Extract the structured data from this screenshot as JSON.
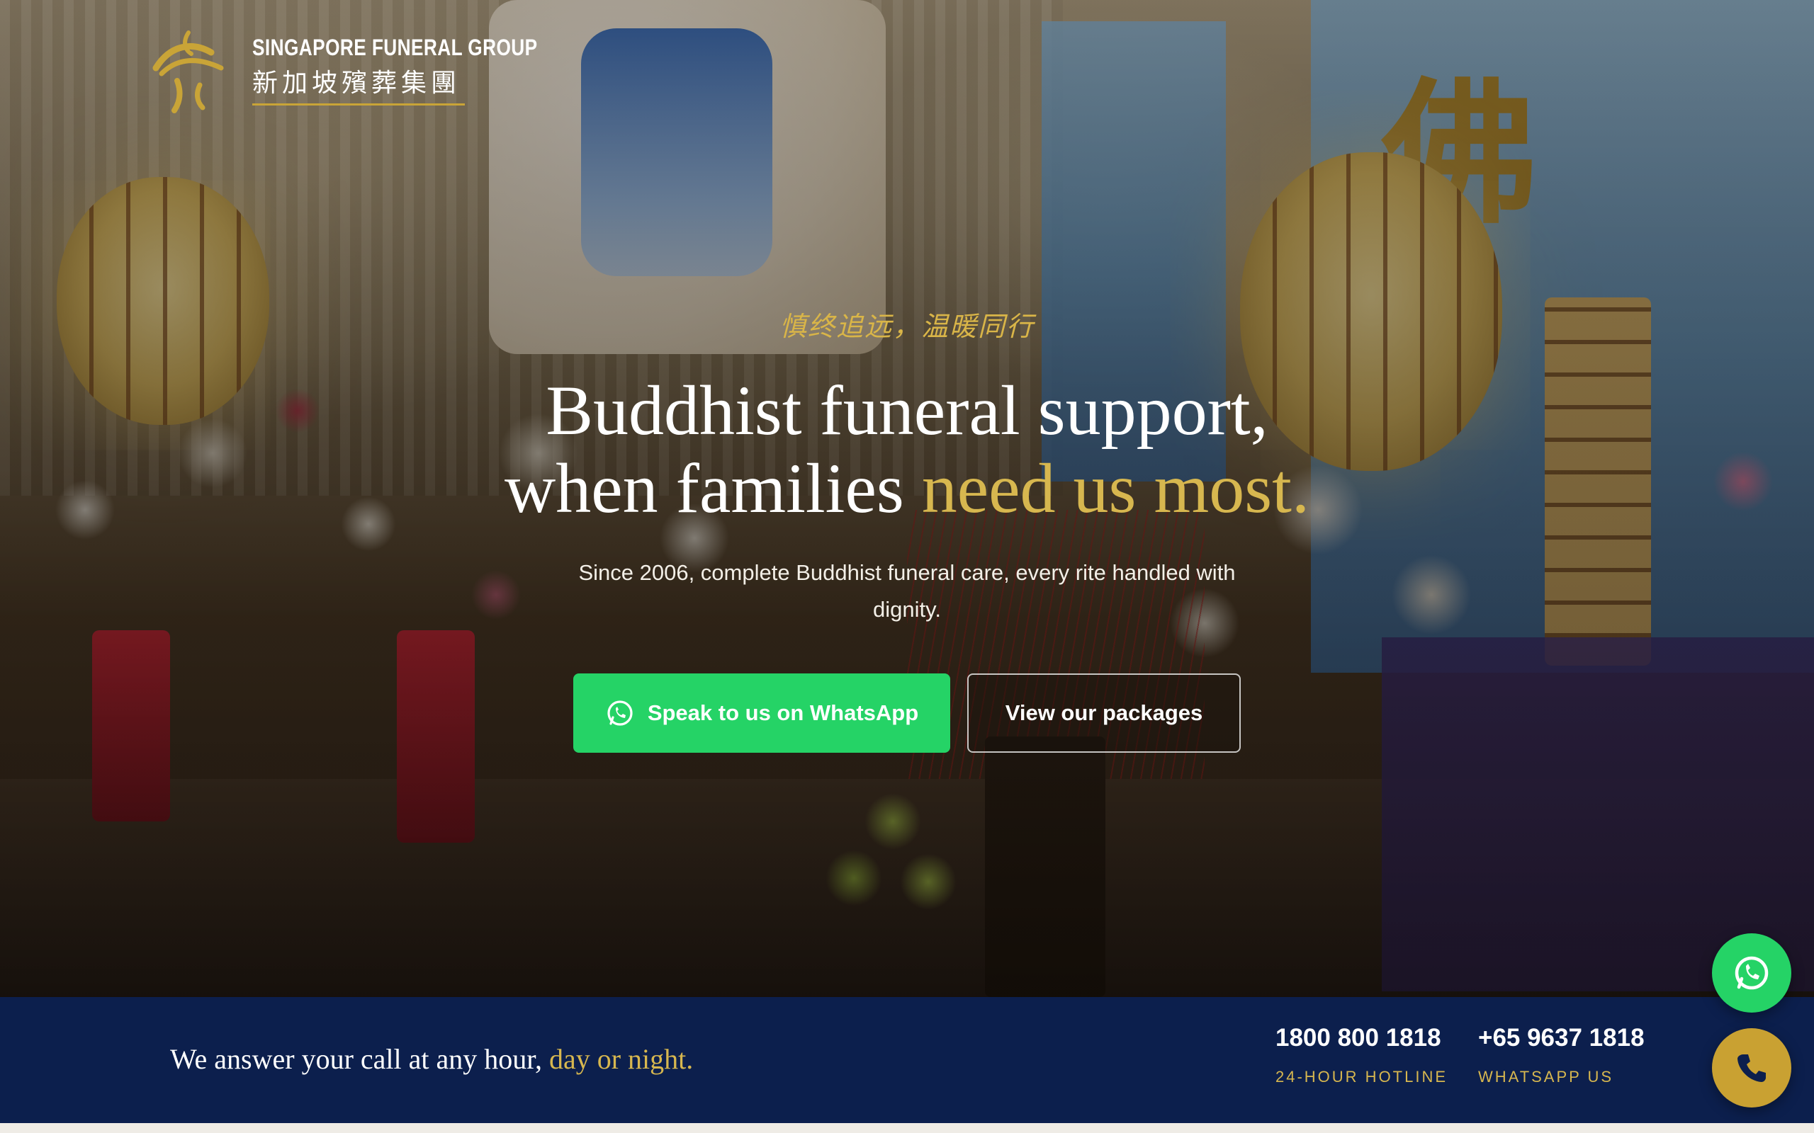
{
  "brand": {
    "name_en": "SINGAPORE FUNERAL GROUP",
    "name_zh": "新加坡殯葬集團",
    "gold": "#c9a437",
    "navy": "#0c1f4d",
    "whatsapp_green": "#25d366"
  },
  "hero": {
    "tagline_zh": "慎终追远，温暖同行",
    "headline_line1": "Buddhist funeral support,",
    "headline_line2_white": "when families ",
    "headline_line2_gold": "need us most.",
    "subline": "Since 2006, complete Buddhist funeral care, every rite handled with dignity.",
    "primary_cta": "Speak to us on WhatsApp",
    "secondary_cta": "View our packages",
    "background_text_zh": "佛"
  },
  "contact_bar": {
    "message_white": "We answer your call at any hour, ",
    "message_gold": "day or night.",
    "hotline_number": "1800 800 1818",
    "hotline_label": "24-HOUR HOTLINE",
    "whatsapp_number": "+65 9637 1818",
    "whatsapp_label": "WHATSAPP US"
  },
  "floating": {
    "whatsapp_icon": "whatsapp-icon",
    "phone_icon": "phone-icon"
  }
}
